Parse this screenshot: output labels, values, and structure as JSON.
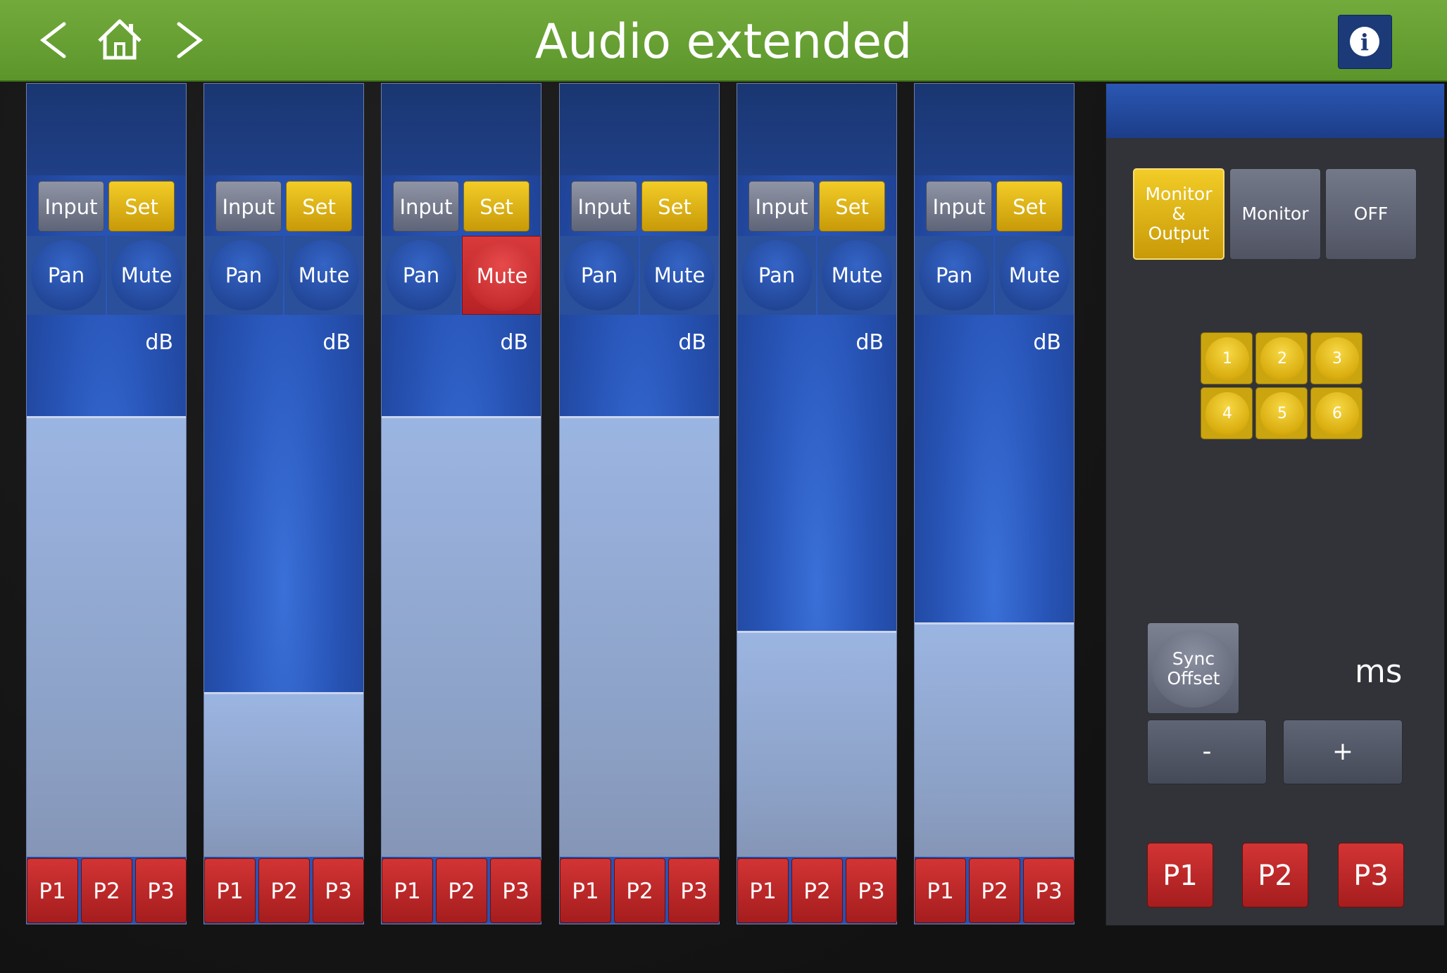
{
  "header": {
    "title": "Audio extended",
    "back_icon": "chevron-left-icon",
    "home_icon": "home-icon",
    "forward_icon": "chevron-right-icon",
    "info_icon": "info-icon",
    "info_symbol": "i"
  },
  "colors": {
    "header_green": "#6aa232",
    "strip_blue": "#2855b8",
    "set_yellow": "#e0b515",
    "preset_red": "#c02a2b",
    "mute_active_red": "#d13536"
  },
  "channels": [
    {
      "input_label": "Input",
      "set_label": "Set",
      "pan_label": "Pan",
      "mute_label": "Mute",
      "mute_active": false,
      "unit": "dB",
      "fader_level": 1.0,
      "presets": [
        "P1",
        "P2",
        "P3"
      ]
    },
    {
      "input_label": "Input",
      "set_label": "Set",
      "pan_label": "Pan",
      "mute_label": "Mute",
      "mute_active": false,
      "unit": "dB",
      "fader_level": 0.37,
      "presets": [
        "P1",
        "P2",
        "P3"
      ]
    },
    {
      "input_label": "Input",
      "set_label": "Set",
      "pan_label": "Pan",
      "mute_label": "Mute",
      "mute_active": true,
      "unit": "dB",
      "fader_level": 1.0,
      "presets": [
        "P1",
        "P2",
        "P3"
      ]
    },
    {
      "input_label": "Input",
      "set_label": "Set",
      "pan_label": "Pan",
      "mute_label": "Mute",
      "mute_active": false,
      "unit": "dB",
      "fader_level": 1.0,
      "presets": [
        "P1",
        "P2",
        "P3"
      ]
    },
    {
      "input_label": "Input",
      "set_label": "Set",
      "pan_label": "Pan",
      "mute_label": "Mute",
      "mute_active": false,
      "unit": "dB",
      "fader_level": 0.51,
      "presets": [
        "P1",
        "P2",
        "P3"
      ]
    },
    {
      "input_label": "Input",
      "set_label": "Set",
      "pan_label": "Pan",
      "mute_label": "Mute",
      "mute_active": false,
      "unit": "dB",
      "fader_level": 0.53,
      "presets": [
        "P1",
        "P2",
        "P3"
      ]
    }
  ],
  "panel": {
    "modes": [
      {
        "label_line1": "Monitor",
        "label_line2": "&",
        "label_line3": "Output",
        "active": true
      },
      {
        "label": "Monitor",
        "active": false
      },
      {
        "label": "OFF",
        "active": false
      }
    ],
    "numbers": [
      "1",
      "2",
      "3",
      "4",
      "5",
      "6"
    ],
    "sync_line1": "Sync",
    "sync_line2": "Offset",
    "unit": "ms",
    "minus_label": "-",
    "plus_label": "+",
    "presets": [
      "P1",
      "P2",
      "P3"
    ]
  }
}
